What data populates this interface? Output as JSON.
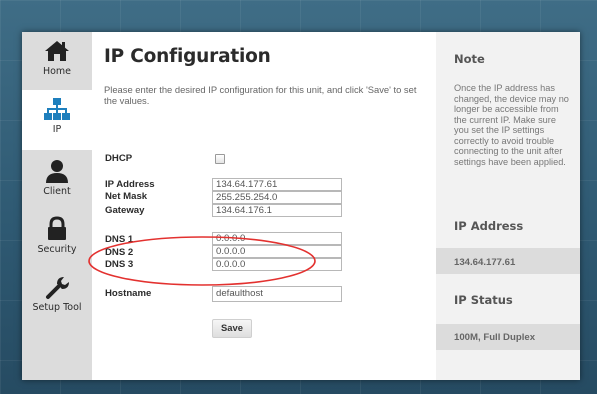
{
  "sidebar": {
    "items": [
      {
        "label": "Home",
        "icon": "home-icon"
      },
      {
        "label": "IP",
        "icon": "network-icon",
        "active": true
      },
      {
        "label": "Client",
        "icon": "user-icon"
      },
      {
        "label": "Security",
        "icon": "lock-icon"
      },
      {
        "label": "Setup Tool",
        "icon": "wrench-icon"
      }
    ]
  },
  "main": {
    "title": "IP Configuration",
    "intro": "Please enter the desired IP configuration for this unit, and click 'Save' to set the values.",
    "dhcp_label": "DHCP",
    "dhcp_checked": false,
    "ip_address_label": "IP Address",
    "ip_address_value": "134.64.177.61",
    "net_mask_label": "Net Mask",
    "net_mask_value": "255.255.254.0",
    "gateway_label": "Gateway",
    "gateway_value": "134.64.176.1",
    "dns1_label": "DNS 1",
    "dns1_value": "0.0.0.0",
    "dns2_label": "DNS 2",
    "dns2_value": "0.0.0.0",
    "dns3_label": "DNS 3",
    "dns3_value": "0.0.0.0",
    "hostname_label": "Hostname",
    "hostname_value": "defaulthost",
    "save_label": "Save",
    "annotation_color": "#e3312f"
  },
  "right": {
    "note_title": "Note",
    "note_text": "Once the IP address has changed, the device may no longer be accessible from the current IP. Make sure you set the IP settings correctly to avoid trouble connecting to the unit after settings have been applied.",
    "ip_address_title": "IP Address",
    "ip_address_value": "134.64.177.61",
    "ip_status_title": "IP Status",
    "ip_status_value": "100M, Full Duplex"
  },
  "colors": {
    "accent": "#1e7fbd",
    "background": "#34627c"
  }
}
